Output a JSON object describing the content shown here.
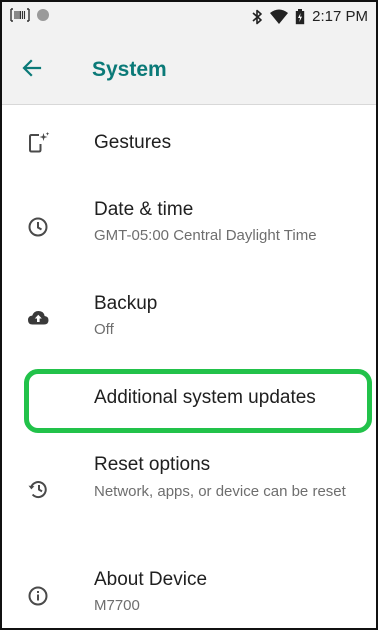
{
  "status_bar": {
    "time": "2:17 PM",
    "left_icons": [
      "barcode-scanner-icon",
      "notification-dot-icon"
    ],
    "right_icons": [
      "bluetooth-icon",
      "wifi-icon",
      "battery-icon"
    ]
  },
  "app_bar": {
    "title": "System",
    "accent_color": "#0b7a78"
  },
  "items": [
    {
      "id": "gestures",
      "icon": "gestures-icon",
      "title": "Gestures",
      "subtitle": ""
    },
    {
      "id": "date-time",
      "icon": "clock-icon",
      "title": "Date & time",
      "subtitle": "GMT-05:00 Central Daylight Time"
    },
    {
      "id": "backup",
      "icon": "cloud-upload-icon",
      "title": "Backup",
      "subtitle": "Off"
    },
    {
      "id": "additional-updates",
      "icon": "",
      "title": "Additional system updates",
      "subtitle": ""
    },
    {
      "id": "reset",
      "icon": "history-icon",
      "title": "Reset options",
      "subtitle": "Network, apps, or device can be reset"
    },
    {
      "id": "about",
      "icon": "info-icon",
      "title": "About Device",
      "subtitle": "M7700"
    }
  ],
  "highlight_color": "#22c24a"
}
